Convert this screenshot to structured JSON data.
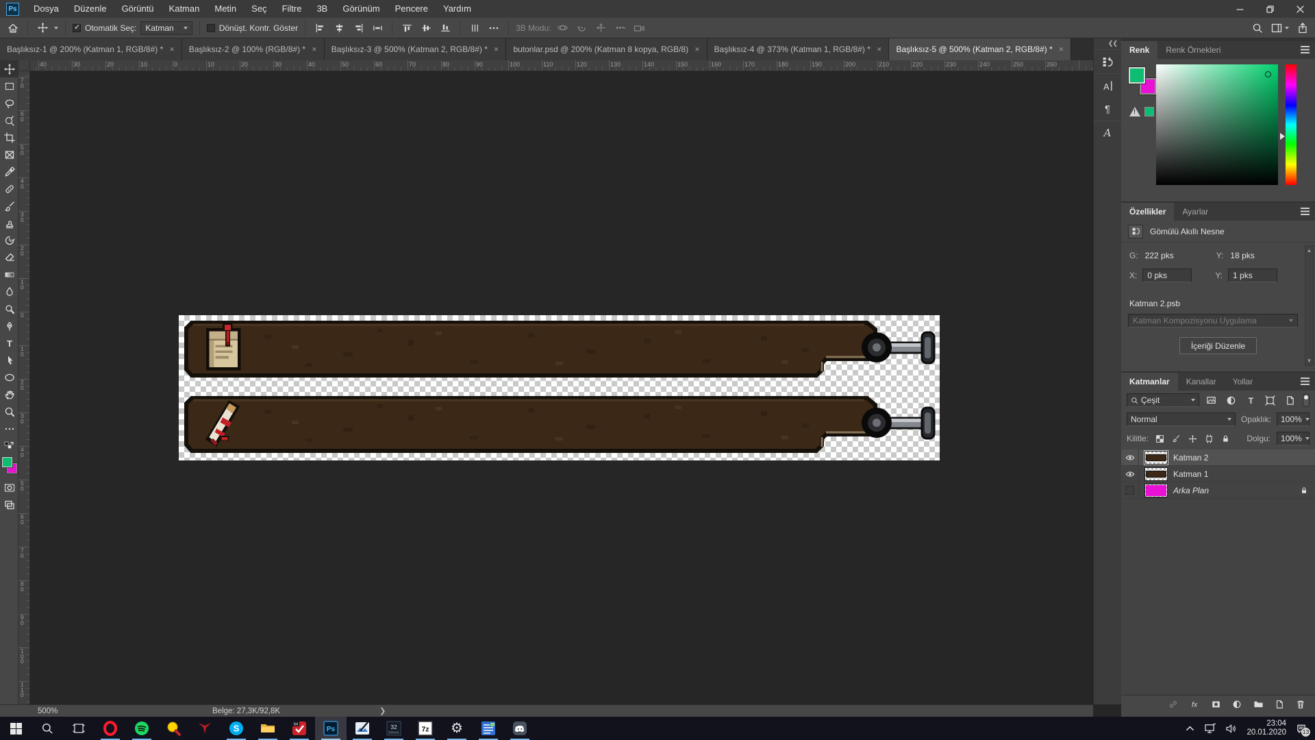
{
  "menu": {
    "items": [
      "Dosya",
      "Düzenle",
      "Görüntü",
      "Katman",
      "Metin",
      "Seç",
      "Filtre",
      "3B",
      "Görünüm",
      "Pencere",
      "Yardım"
    ]
  },
  "options": {
    "auto_select_label": "Otomatik Seç:",
    "auto_select_value": "Katman",
    "transform_label": "Dönüşt. Kontr. Göster",
    "mode3d_label": "3B Modu:"
  },
  "tabs": [
    {
      "label": "Başlıksız-1 @ 200% (Katman 1, RGB/8#) *"
    },
    {
      "label": "Başlıksız-2 @ 100% (RGB/8#) *"
    },
    {
      "label": "Başlıksız-3 @ 500% (Katman 2, RGB/8#) *"
    },
    {
      "label": "butonlar.psd @ 200% (Katman 8 kopya, RGB/8)"
    },
    {
      "label": "Başlıksız-4 @ 373% (Katman 1, RGB/8#) *"
    },
    {
      "label": "Başlıksız-5 @ 500% (Katman 2, RGB/8#) *"
    }
  ],
  "rulers": {
    "top": [
      "40",
      "30",
      "20",
      "10",
      "0",
      "10",
      "20",
      "30",
      "40",
      "50",
      "60",
      "70",
      "80",
      "90",
      "100",
      "110",
      "120",
      "130",
      "140",
      "150",
      "160",
      "170",
      "180",
      "190",
      "200",
      "210",
      "220",
      "230",
      "240",
      "250",
      "260"
    ],
    "left": [
      "70",
      "60",
      "50",
      "40",
      "30",
      "20",
      "10",
      "0",
      "10",
      "20",
      "30",
      "40",
      "50",
      "60",
      "70",
      "80",
      "90",
      "100",
      "110"
    ]
  },
  "status": {
    "zoom": "500%",
    "doc_info": "Belge: 27,3K/92,8K"
  },
  "colors": {
    "foreground": "#0cbd72",
    "background": "#e912d4"
  },
  "panels": {
    "color": {
      "tabs": [
        "Renk",
        "Renk Örnekleri"
      ]
    },
    "properties": {
      "tabs": [
        "Özellikler",
        "Ayarlar"
      ],
      "object_label": "Gömülü Akıllı Nesne",
      "w_label": "G:",
      "w_value": "222 pks",
      "h_label": "Y:",
      "h_value": "18 pks",
      "x_label": "X:",
      "x_value": "0 pks",
      "y_label": "Y:",
      "y_value": "1 pks",
      "file_name": "Katman 2.psb",
      "layer_comp_placeholder": "Katman Kompozisyonu Uygulama",
      "edit_button": "İçeriği Düzenle"
    },
    "layers": {
      "tabs": [
        "Katmanlar",
        "Kanallar",
        "Yollar"
      ],
      "filter_value": "Çeşit",
      "blend_mode": "Normal",
      "opacity_label": "Opaklık:",
      "opacity_value": "100%",
      "lock_label": "Kilitle:",
      "fill_label": "Dolgu:",
      "fill_value": "100%",
      "items": [
        {
          "name": "Katman 2"
        },
        {
          "name": "Katman 1"
        },
        {
          "name": "Arka Plan"
        }
      ]
    }
  },
  "taskbar": {
    "time": "23:04",
    "date": "20.01.2020",
    "badge": "13"
  }
}
